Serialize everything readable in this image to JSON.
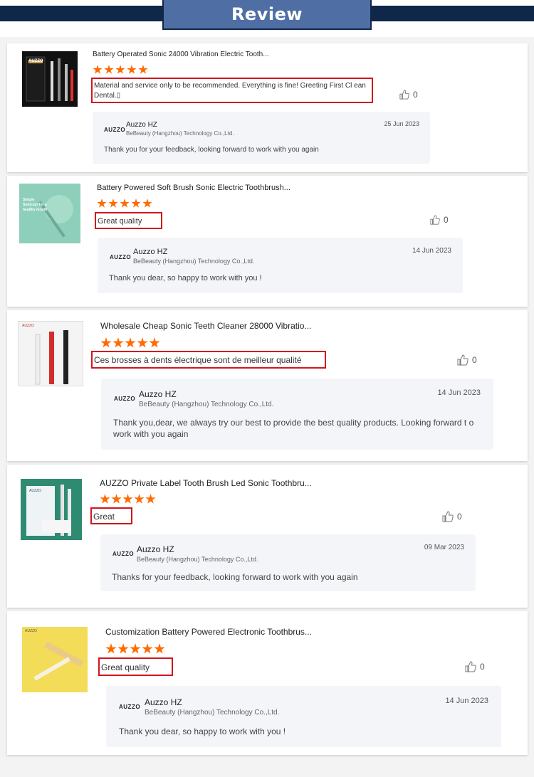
{
  "header": {
    "title": "Review"
  },
  "colors": {
    "star": "#ff6a00",
    "highlight_border": "#d0161c",
    "banner_dark": "#0f2748",
    "banner_tab": "#4f6fa4"
  },
  "reviews": [
    {
      "product_title": "Battery Operated Sonic 24000 Vibration Electric Tooth...",
      "rating": 5,
      "comment": "Material and service only to be recommended. Everything is fine! Greeting First Cl ean Dental.▯",
      "likes": "0",
      "image_label": "AUZZO",
      "reply": {
        "logo": "AUZZO",
        "seller": "Auzzo HZ",
        "company": "BeBeauty (Hangzhou) Technology Co.,Ltd.",
        "date": "25 Jun 2023",
        "text": "Thank you for your feedback, looking forward to work with you again"
      }
    },
    {
      "product_title": "Battery Powered Soft Brush Sonic Electric Toothbrush...",
      "rating": 5,
      "comment": "Great quality",
      "likes": "0",
      "image_label": "Simple Sonicnyr for a healthy mouth",
      "reply": {
        "logo": "AUZZO",
        "seller": "Auzzo HZ",
        "company": "BeBeauty (Hangzhou) Technology Co.,Ltd.",
        "date": "14 Jun 2023",
        "text": "Thank you dear, so happy to work with you !"
      }
    },
    {
      "product_title": "Wholesale Cheap Sonic Teeth Cleaner 28000 Vibratio...",
      "rating": 5,
      "comment": "Ces brosses à dents électrique sont de meilleur qualité",
      "likes": "0",
      "image_label": "AUZZO",
      "reply": {
        "logo": "AUZZO",
        "seller": "Auzzo HZ",
        "company": "BeBeauty (Hangzhou) Technology Co.,Ltd.",
        "date": "14 Jun 2023",
        "text": "Thank you,dear, we always try our best to provide the best quality products. Looking forward t o work with you again"
      }
    },
    {
      "product_title": "AUZZO Private Label Tooth Brush Led Sonic Toothbru...",
      "rating": 5,
      "comment": "Great",
      "likes": "0",
      "image_label": "AUZZO",
      "reply": {
        "logo": "AUZZO",
        "seller": "Auzzo HZ",
        "company": "BeBeauty (Hangzhou) Technology Co.,Ltd.",
        "date": "09 Mar 2023",
        "text": "Thanks for your feedback, looking forward to work with you again"
      }
    },
    {
      "product_title": "Customization Battery Powered Electronic Toothbrus...",
      "rating": 5,
      "comment": "Great quality",
      "likes": "0",
      "image_label": "AUZZO",
      "reply": {
        "logo": "AUZZO",
        "seller": "Auzzo HZ",
        "company": "BeBeauty (Hangzhou) Technology Co.,Ltd.",
        "date": "14 Jun 2023",
        "text": "Thank you dear, so happy to work with you !"
      }
    }
  ]
}
